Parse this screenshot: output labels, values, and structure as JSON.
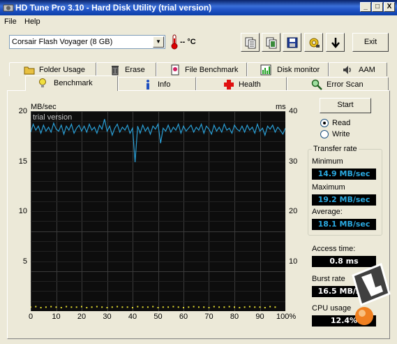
{
  "window": {
    "title": "HD Tune Pro 3.10 - Hard Disk Utility (trial version)",
    "min_label": "_",
    "max_label": "□",
    "close_label": "X"
  },
  "menu": {
    "file": "File",
    "help": "Help"
  },
  "toolbar": {
    "drive": "Corsair Flash Voyager (8 GB)",
    "temperature": "-- °C",
    "buttons": [
      "copy-info-icon",
      "copy-screen-icon",
      "save-icon",
      "options-icon",
      "download-icon"
    ],
    "exit_label": "Exit"
  },
  "tabs_top": [
    {
      "label": "Folder Usage",
      "icon": "folder-icon"
    },
    {
      "label": "Erase",
      "icon": "trash-icon"
    },
    {
      "label": "File Benchmark",
      "icon": "file-icon"
    },
    {
      "label": "Disk monitor",
      "icon": "monitor-chart-icon"
    },
    {
      "label": "AAM",
      "icon": "speaker-icon"
    }
  ],
  "tabs_bottom": [
    {
      "label": "Benchmark",
      "icon": "bulb-icon",
      "active": true
    },
    {
      "label": "Info",
      "icon": "info-icon"
    },
    {
      "label": "Health",
      "icon": "health-cross-icon"
    },
    {
      "label": "Error Scan",
      "icon": "magnifier-icon"
    }
  ],
  "benchmark": {
    "start_label": "Start",
    "read_label": "Read",
    "write_label": "Write",
    "mode": "Read",
    "transfer_rate_title": "Transfer rate",
    "minimum_label": "Minimum",
    "minimum_value": "14.9 MB/sec",
    "maximum_label": "Maximum",
    "maximum_value": "19.2 MB/sec",
    "average_label": "Average:",
    "average_value": "18.1 MB/sec",
    "access_time_label": "Access time:",
    "access_time_value": "0.8 ms",
    "burst_rate_label": "Burst rate",
    "burst_rate_value": "16.5 MB/sec",
    "cpu_usage_label": "CPU usage",
    "cpu_usage_value": "12.4%"
  },
  "chart_data": {
    "type": "line",
    "watermark": "trial version",
    "ylabel_left": "MB/sec",
    "ylabel_right": "ms",
    "ylim_left": [
      0,
      20
    ],
    "ylim_right": [
      0,
      40
    ],
    "y_ticks_left": [
      "20",
      "15",
      "10",
      "5"
    ],
    "y_ticks_right": [
      "40",
      "30",
      "20",
      "10"
    ],
    "x_ticks": [
      "0",
      "10",
      "20",
      "30",
      "40",
      "50",
      "60",
      "70",
      "80",
      "90",
      "100%"
    ],
    "xlim": [
      0,
      100
    ],
    "grid": true,
    "series": [
      {
        "name": "Transfer rate",
        "axis": "left",
        "color": "#2a9fd6",
        "x": [
          0,
          1,
          2,
          3,
          4,
          5,
          6,
          7,
          8,
          9,
          10,
          11,
          12,
          13,
          14,
          15,
          16,
          17,
          18,
          19,
          20,
          21,
          22,
          23,
          24,
          25,
          26,
          27,
          28,
          29,
          30,
          31,
          32,
          33,
          34,
          35,
          36,
          37,
          38,
          39,
          40,
          41,
          42,
          43,
          44,
          45,
          46,
          47,
          48,
          49,
          50,
          51,
          52,
          53,
          54,
          55,
          56,
          57,
          58,
          59,
          60,
          61,
          62,
          63,
          64,
          65,
          66,
          67,
          68,
          69,
          70,
          71,
          72,
          73,
          74,
          75,
          76,
          77,
          78,
          79,
          80,
          81,
          82,
          83,
          84,
          85,
          86,
          87,
          88,
          89,
          90,
          91,
          92,
          93,
          94,
          95,
          96,
          97,
          98,
          99,
          100
        ],
        "values": [
          17.9,
          18.7,
          18.1,
          18.5,
          17.8,
          18.6,
          18.0,
          18.4,
          17.9,
          18.8,
          18.2,
          18.0,
          18.6,
          17.7,
          18.5,
          18.1,
          18.7,
          17.8,
          18.3,
          18.6,
          18.0,
          18.5,
          17.9,
          18.7,
          18.1,
          18.4,
          17.8,
          18.6,
          18.2,
          19.2,
          18.0,
          18.5,
          17.6,
          18.3,
          18.7,
          17.9,
          18.4,
          18.1,
          18.6,
          17.8,
          18.3,
          14.9,
          18.5,
          17.8,
          18.6,
          18.0,
          18.4,
          17.7,
          18.5,
          18.2,
          18.7,
          16.8,
          18.3,
          18.0,
          18.6,
          17.9,
          18.4,
          18.1,
          18.7,
          17.8,
          18.5,
          18.0,
          18.3,
          18.6,
          17.9,
          18.4,
          18.1,
          18.7,
          17.8,
          18.5,
          18.2,
          17.7,
          18.6,
          18.0,
          18.4,
          17.9,
          18.7,
          18.1,
          18.3,
          17.8,
          18.6,
          18.2,
          18.0,
          18.5,
          17.9,
          18.6,
          18.1,
          18.4,
          17.8,
          18.7,
          18.0,
          18.3,
          17.6,
          18.5,
          18.2,
          18.6,
          17.9,
          18.4,
          18.1,
          17.7,
          18.3
        ]
      },
      {
        "name": "Access time",
        "axis": "right",
        "color": "#e8e030",
        "style": "points",
        "x": [
          0,
          2,
          4,
          6,
          8,
          10,
          12,
          14,
          16,
          18,
          20,
          22,
          24,
          26,
          28,
          30,
          32,
          34,
          36,
          38,
          40,
          42,
          44,
          46,
          48,
          50,
          52,
          54,
          56,
          58,
          60,
          62,
          64,
          66,
          68,
          70,
          72,
          74,
          76,
          78,
          80,
          82,
          84,
          86,
          88,
          90,
          92,
          94,
          96
        ],
        "values": [
          0.8,
          0.9,
          0.7,
          0.8,
          0.9,
          0.8,
          0.7,
          0.9,
          0.8,
          0.8,
          0.9,
          0.7,
          0.8,
          0.9,
          0.8,
          0.7,
          0.8,
          0.9,
          0.8,
          0.8,
          0.7,
          0.9,
          0.8,
          0.8,
          0.9,
          0.7,
          0.8,
          0.8,
          0.9,
          0.8,
          0.7,
          0.8,
          0.9,
          0.8,
          0.8,
          0.7,
          0.9,
          0.8,
          0.8,
          0.9,
          0.8,
          0.7,
          0.8,
          0.9,
          0.8,
          0.8,
          0.7,
          0.9,
          0.8
        ]
      }
    ]
  }
}
